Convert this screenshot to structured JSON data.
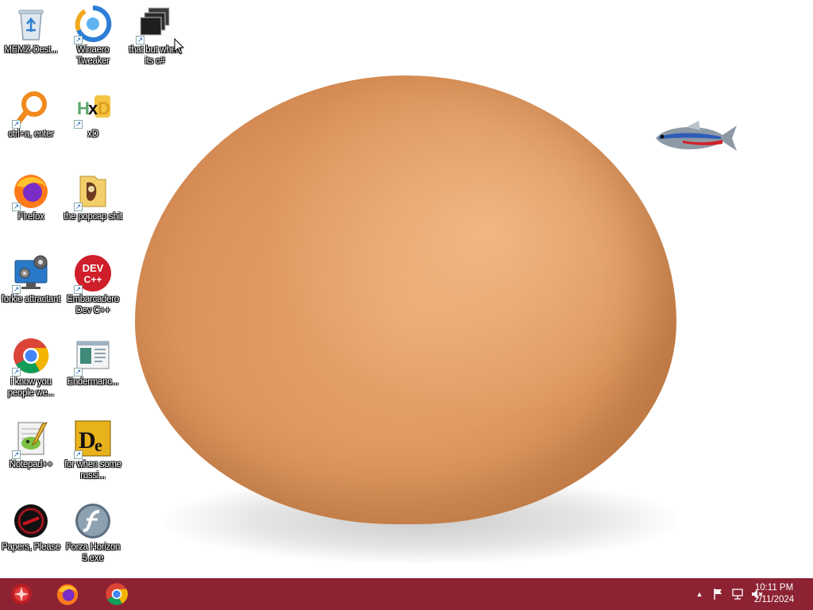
{
  "desktop": {
    "icons": [
      {
        "label": "MEMZ-Dest...",
        "icon": "recycle-bin-icon"
      },
      {
        "label": "Winaero Tweaker",
        "icon": "winaero-icon"
      },
      {
        "label": "that but when its c#",
        "icon": "stacked-windows-icon"
      },
      {
        "label": "ctrl+a, enter",
        "icon": "magnifier-icon"
      },
      {
        "label": "xD",
        "icon": "hxd-icon"
      },
      {
        "label": "Firefox",
        "icon": "firefox-icon"
      },
      {
        "label": "the popcap shit",
        "icon": "folder-icon"
      },
      {
        "label": "forkie attractant",
        "icon": "monitor-gear-icon"
      },
      {
        "label": "Embarcadero Dev C++",
        "icon": "devcpp-icon"
      },
      {
        "label": "i know you people we...",
        "icon": "chrome-icon"
      },
      {
        "label": "Endermanc...",
        "icon": "window-app-icon"
      },
      {
        "label": "Notepad++",
        "icon": "notepadpp-icon"
      },
      {
        "label": "for when some russi...",
        "icon": "de-app-icon"
      },
      {
        "label": "Papers, Please",
        "icon": "papers-please-icon"
      },
      {
        "label": "Forza Horizon 5.exe",
        "icon": "flash-icon"
      }
    ]
  },
  "devcpp": {
    "line1": "DEV",
    "line2": "C++"
  },
  "taskbar": {
    "pinned": [
      "start-orb-icon",
      "firefox-icon",
      "chrome-icon"
    ],
    "tray": {
      "chevron": "▲"
    },
    "clock": {
      "time": "10:11 PM",
      "date": "2/11/2024"
    }
  },
  "colors": {
    "taskbar": "#8c2232",
    "egg": "#dc955c"
  }
}
